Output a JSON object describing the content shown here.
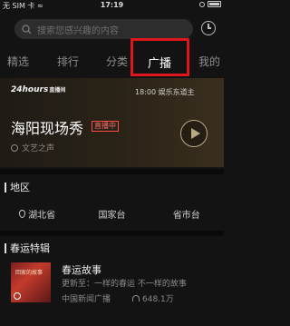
{
  "status_bar": {
    "carrier": "无 SIM 卡 ≈",
    "time": "17:19"
  },
  "search": {
    "placeholder": "搜索您感兴趣的内容",
    "icon": "search-icon"
  },
  "tabs": [
    {
      "label": "精选"
    },
    {
      "label": "排行"
    },
    {
      "label": "分类"
    },
    {
      "label": "广播",
      "active": true
    },
    {
      "label": "我的"
    }
  ],
  "banner": {
    "brand": "24hours",
    "brand_sub": "直播间",
    "time_label": "18:00 娱乐东道主",
    "show_title": "海阳现场秀",
    "live_badge": "直播中",
    "channel": "文艺之声"
  },
  "region": {
    "title": "地区",
    "items": [
      {
        "label": "湖北省",
        "icon": "location-icon"
      },
      {
        "label": "国家台"
      },
      {
        "label": "省市台"
      }
    ]
  },
  "special": {
    "title": "春运特辑",
    "item": {
      "thumb_text": "回家的故事",
      "title": "春运故事",
      "desc": "更新至：一样的春运 不一样的故事",
      "source": "中国新闻广播",
      "listens": "648.1万"
    }
  },
  "colors": {
    "accent_red": "#e0161d",
    "background": "#131313"
  }
}
